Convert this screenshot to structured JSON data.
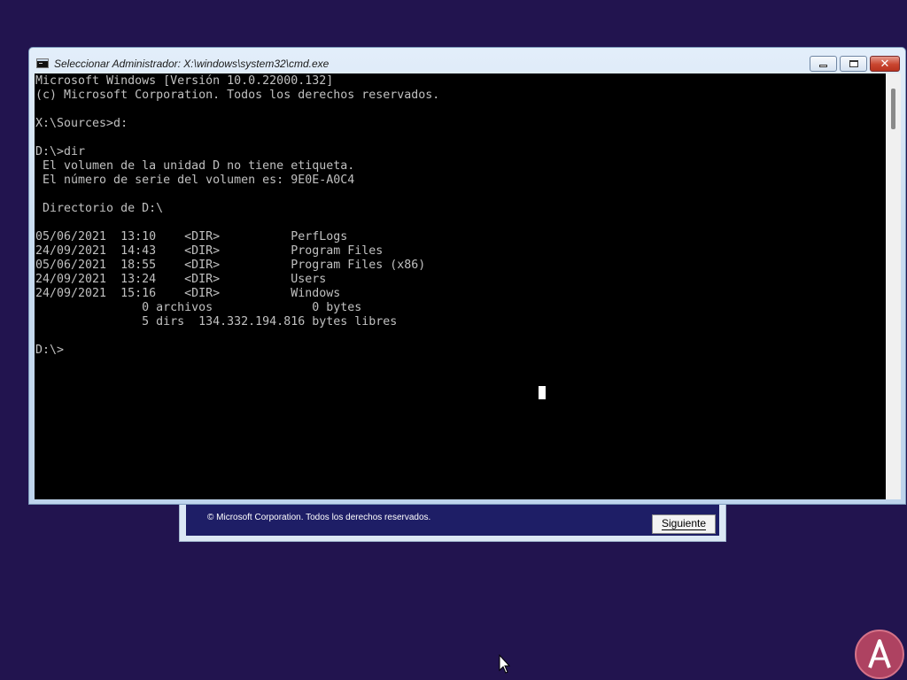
{
  "cmd_window": {
    "title": "Seleccionar Administrador: X:\\windows\\system32\\cmd.exe",
    "icon": "cmd-icon",
    "controls": {
      "minimize": "minimize-icon",
      "maximize": "maximize-icon",
      "close": "✕"
    },
    "console": {
      "text_color": "#c0c0c0",
      "background": "#000000",
      "lines": [
        "Microsoft Windows [Versión 10.0.22000.132]",
        "(c) Microsoft Corporation. Todos los derechos reservados.",
        "",
        "X:\\Sources>d:",
        "",
        "D:\\>dir",
        " El volumen de la unidad D no tiene etiqueta.",
        " El número de serie del volumen es: 9E0E-A0C4",
        "",
        " Directorio de D:\\",
        "",
        "05/06/2021  13:10    <DIR>          PerfLogs",
        "24/09/2021  14:43    <DIR>          Program Files",
        "05/06/2021  18:55    <DIR>          Program Files (x86)",
        "24/09/2021  13:24    <DIR>          Users",
        "24/09/2021  15:16    <DIR>          Windows",
        "               0 archivos              0 bytes",
        "               5 dirs  134.332.194.816 bytes libres",
        "",
        "D:\\>"
      ]
    }
  },
  "setup_window": {
    "copyright": "© Microsoft Corporation. Todos los derechos reservados.",
    "next_button": "Siguiente"
  },
  "colors": {
    "desktop": "#22144f",
    "setup_panel": "#1e1e66"
  }
}
